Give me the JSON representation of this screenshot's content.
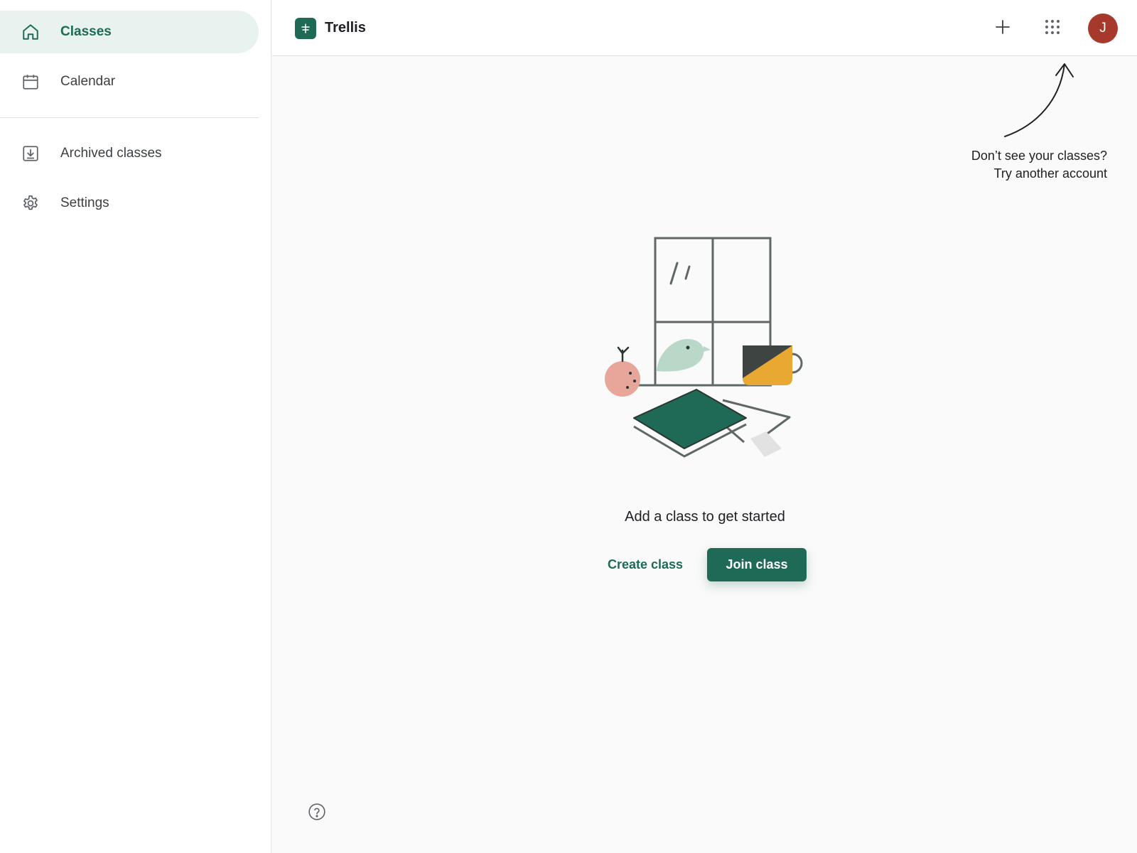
{
  "sidebar": {
    "items": [
      {
        "label": "Classes",
        "icon": "home-icon",
        "active": true
      },
      {
        "label": "Calendar",
        "icon": "calendar-icon"
      },
      {
        "label": "Archived classes",
        "icon": "archive-icon"
      },
      {
        "label": "Settings",
        "icon": "gear-icon"
      }
    ]
  },
  "header": {
    "app_name": "Trellis",
    "logo_icon": "trellis-logo-icon",
    "add_icon": "plus-icon",
    "apps_icon": "apps-grid-icon",
    "avatar_initial": "J",
    "avatar_color": "#a6392c"
  },
  "account_hint": {
    "line1": "Don’t see your classes?",
    "line2": "Try another account"
  },
  "empty_state": {
    "title": "Add a class to get started",
    "create_label": "Create class",
    "join_label": "Join class"
  },
  "footer": {
    "help_icon": "help-icon"
  },
  "colors": {
    "accent": "#1e6a56",
    "active_bg": "#e8f2ee"
  }
}
